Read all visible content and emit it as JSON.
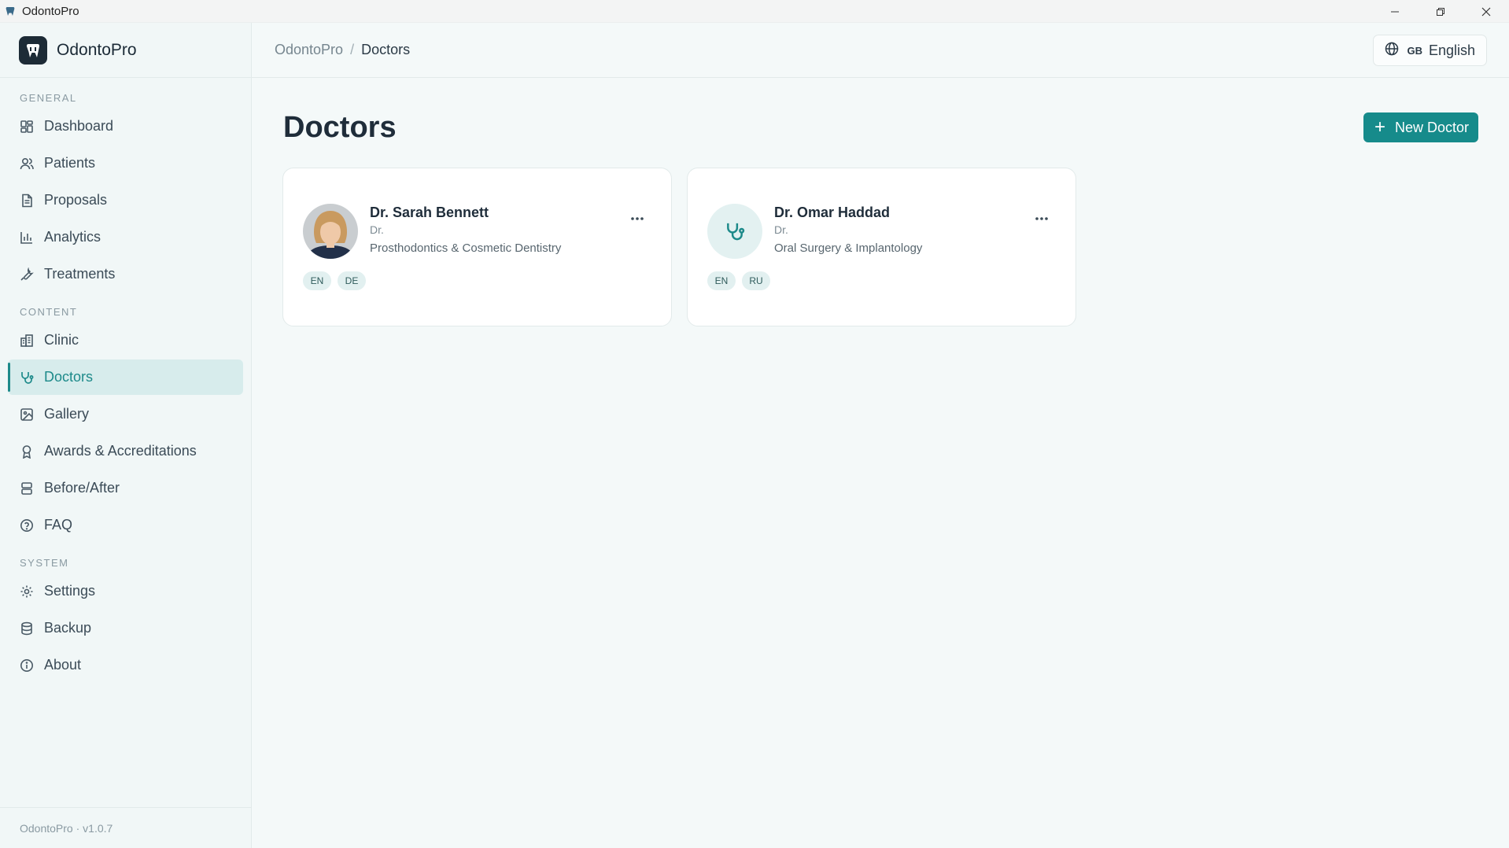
{
  "window": {
    "title": "OdontoPro"
  },
  "brand": {
    "name": "OdontoPro"
  },
  "sidebar": {
    "sections": [
      {
        "label": "GENERAL",
        "items": [
          {
            "label": "Dashboard",
            "icon": "grid-icon"
          },
          {
            "label": "Patients",
            "icon": "users-icon"
          },
          {
            "label": "Proposals",
            "icon": "file-text-icon"
          },
          {
            "label": "Analytics",
            "icon": "bar-chart-icon"
          },
          {
            "label": "Treatments",
            "icon": "wrench-icon"
          }
        ]
      },
      {
        "label": "CONTENT",
        "items": [
          {
            "label": "Clinic",
            "icon": "building-icon"
          },
          {
            "label": "Doctors",
            "icon": "stethoscope-icon",
            "active": true
          },
          {
            "label": "Gallery",
            "icon": "image-icon"
          },
          {
            "label": "Awards & Accreditations",
            "icon": "award-icon"
          },
          {
            "label": "Before/After",
            "icon": "split-icon"
          },
          {
            "label": "FAQ",
            "icon": "help-circle-icon"
          }
        ]
      },
      {
        "label": "SYSTEM",
        "items": [
          {
            "label": "Settings",
            "icon": "gear-icon"
          },
          {
            "label": "Backup",
            "icon": "database-icon"
          },
          {
            "label": "About",
            "icon": "info-icon"
          }
        ]
      }
    ],
    "footer": "OdontoPro · v1.0.7"
  },
  "breadcrumb": {
    "root": "OdontoPro",
    "separator": "/",
    "current": "Doctors"
  },
  "language": {
    "code": "GB",
    "label": "English",
    "icon": "globe-icon"
  },
  "page": {
    "title": "Doctors",
    "new_button": "New Doctor"
  },
  "doctors": [
    {
      "name": "Dr. Sarah Bennett",
      "title": "Dr.",
      "specialty": "Prosthodontics & Cosmetic Dentistry",
      "languages": [
        "EN",
        "DE"
      ],
      "avatar": "photo"
    },
    {
      "name": "Dr. Omar Haddad",
      "title": "Dr.",
      "specialty": "Oral Surgery & Implantology",
      "languages": [
        "EN",
        "RU"
      ],
      "avatar": "stethoscope-icon"
    }
  ],
  "colors": {
    "accent": "#168b8b",
    "active_bg": "#d7ecec",
    "sidebar_bg": "#f1f7f7",
    "page_bg": "#f4f9f9"
  }
}
